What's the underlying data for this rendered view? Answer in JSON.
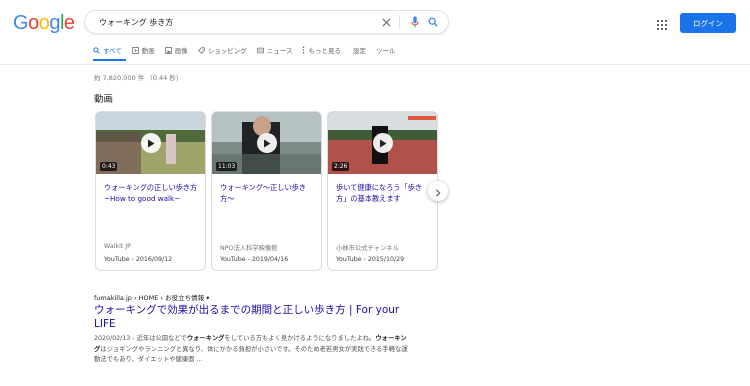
{
  "logo": {
    "letters": [
      "G",
      "o",
      "o",
      "g",
      "l",
      "e"
    ],
    "colors": [
      "#4285F4",
      "#EA4335",
      "#FBBC05",
      "#4285F4",
      "#34A853",
      "#EA4335"
    ]
  },
  "search": {
    "query": "ウォーキング 歩き方",
    "icons": [
      "close-icon",
      "mic-icon",
      "search-icon"
    ]
  },
  "header": {
    "login_label": "ログイン",
    "accent": "#1a73e8"
  },
  "tabs": [
    {
      "label": "すべて",
      "icon": "search-icon",
      "active": true
    },
    {
      "label": "動画",
      "icon": "video-icon"
    },
    {
      "label": "画像",
      "icon": "image-icon"
    },
    {
      "label": "ショッピング",
      "icon": "tag-icon"
    },
    {
      "label": "ニュース",
      "icon": "news-icon"
    },
    {
      "label": "もっと見る",
      "icon": "more-icon"
    },
    {
      "label": "設定"
    },
    {
      "label": "ツール"
    }
  ],
  "result_stats": "約 7,820,000 件 （0.44 秒）",
  "videos": {
    "heading": "動画",
    "items": [
      {
        "duration": "0:43",
        "title": "ウォーキングの正しい歩き方~How to good walk~",
        "source": "Walkit JP",
        "meta": "YouTube - 2016/09/12"
      },
      {
        "duration": "11:03",
        "title": "ウォーキング〜正しい歩き方〜",
        "source": "NPO法人科学映像館",
        "meta": "YouTube - 2019/04/16"
      },
      {
        "duration": "2:26",
        "title": "歩いて健康になろう「歩き方」の基本教えます",
        "source": "小林市公式チャンネル",
        "meta": "YouTube - 2015/10/29"
      }
    ]
  },
  "result": {
    "breadcrumb": "fumakilla.jp › HOME › お役立ち情報 ▾",
    "title": "ウォーキングで効果が出るまでの期間と正しい歩き方 | For your LIFE",
    "snippet_parts": [
      {
        "text": "2020/02/13 - 近年は公園などで"
      },
      {
        "text": "ウォーキング",
        "bold": true
      },
      {
        "text": "をしている方もよく見かけるようになりましたよね。"
      },
      {
        "text": "ウォーキング",
        "bold": true
      },
      {
        "text": "はジョギングやランニングと異なり、体にかかる負担が小さいです。そのため老若男女が実践できる手軽な運動法でもあり、ダイエットや健康面 ..."
      }
    ]
  }
}
